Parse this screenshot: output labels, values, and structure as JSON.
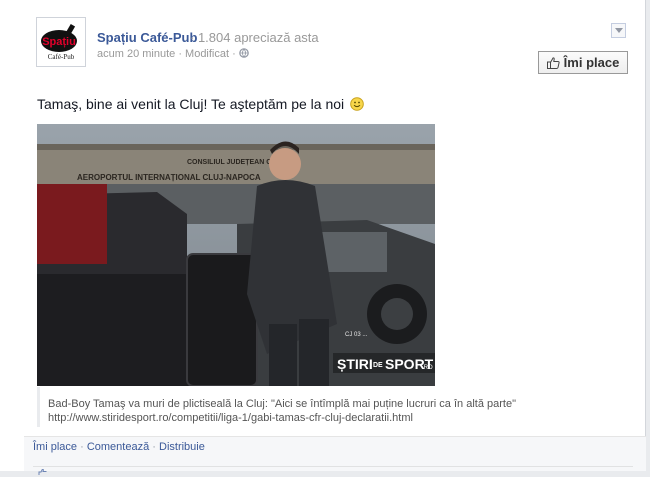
{
  "post": {
    "page_name": "Spațiu Café-Pub",
    "likes_text": "· 1.804 apreciază asta",
    "time_text": "acum 20 minute · Modificat ·",
    "like_page_label": "Îmi place",
    "message": "Tamaş, bine ai venit la Cluj! Te aşteptăm pe la noi",
    "logo_text": "Spațiu",
    "logo_subtext": "Café-Pub"
  },
  "photo": {
    "sign_line1": "CONSILIUL JUDEȚEAN CLUJ",
    "sign_line2": "AEROPORTUL INTERNAȚIONAL CLUJ-NAPOCA",
    "watermark_a": "ȘTIRI",
    "watermark_b": "DE",
    "watermark_c": "SPORT",
    "watermark_d": ".RO",
    "plate": "CJ 03 ..."
  },
  "link": {
    "title": "Bad-Boy Tamaş va muri de plictiseală la Cluj: \"Aici se întîmplă mai puține lucruri ca în altă parte\"",
    "url": "http://www.stiridesport.ro/competitii/liga-1/gabi-tamas-cfr-cluj-declaratii.html"
  },
  "actions": {
    "like": "Îmi place",
    "comment": "Comentează",
    "share": "Distribuie",
    "separator": "·"
  },
  "colors": {
    "link_blue": "#3b5998",
    "muted": "#999999",
    "action_bar": "#f6f7f9"
  }
}
